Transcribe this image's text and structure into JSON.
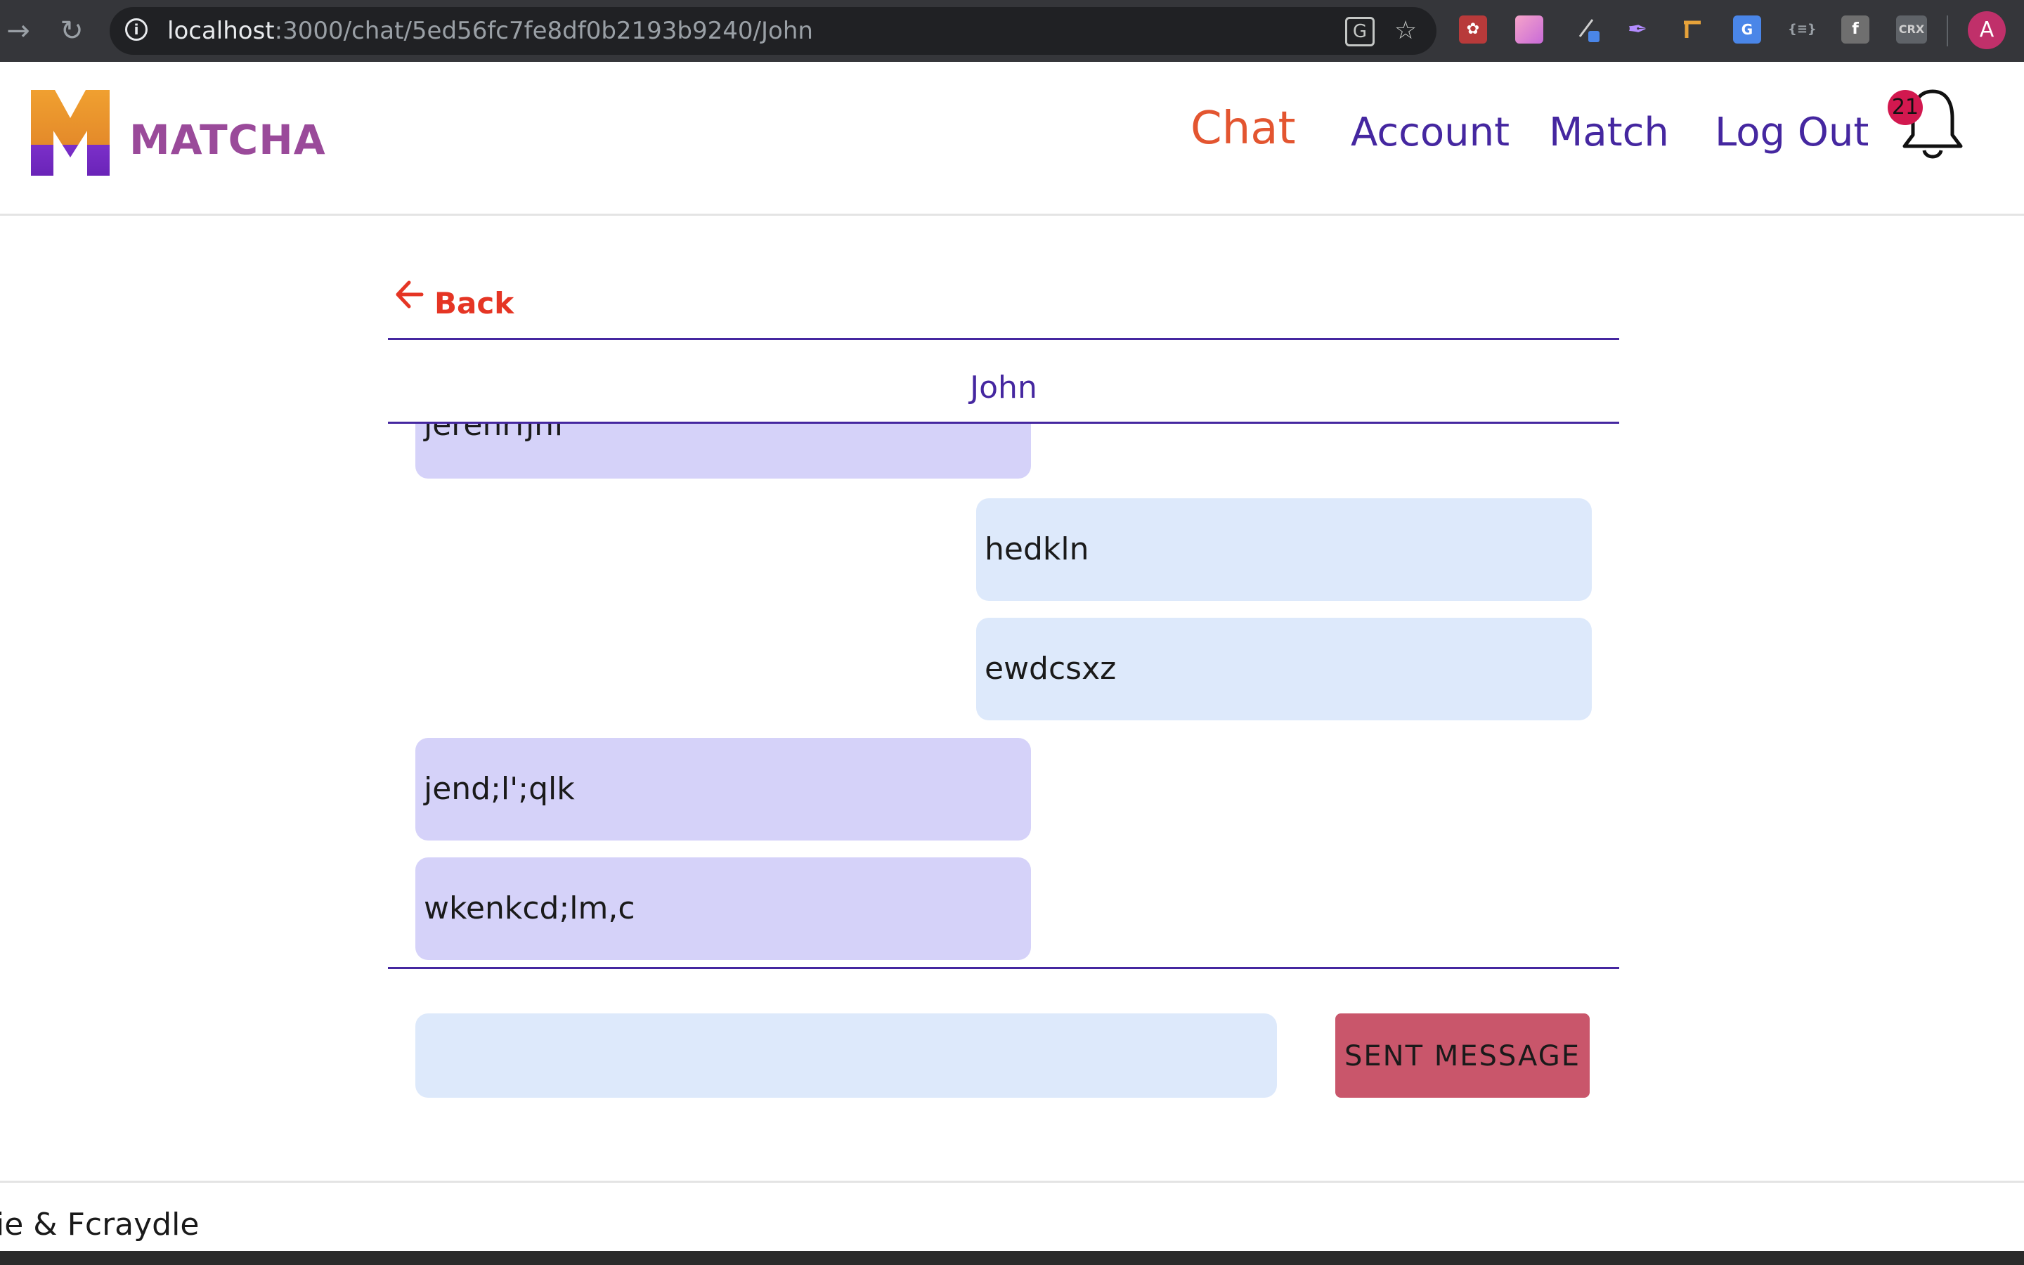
{
  "browser": {
    "url_host": "localhost",
    "url_path": ":3000/chat/5ed56fc7fe8df0b2193b9240/John",
    "profile_initial": "A",
    "extensions": [
      "paw-extension-icon",
      "gradient-extension-icon",
      "picker-extension-icon",
      "feather-extension-icon",
      "ruler-extension-icon",
      "translate-extension-icon",
      "json-extension-icon",
      "f-extension-icon",
      "crx-extension-icon"
    ]
  },
  "header": {
    "logo_text": "MATCHA",
    "nav": {
      "chat": "Chat",
      "account": "Account",
      "match": "Match",
      "logout": "Log Out"
    },
    "notification_count": "21",
    "colors": {
      "active": "#e35530",
      "nav": "#4527a0",
      "badge": "#d2184f"
    }
  },
  "chat": {
    "back_label": "Back",
    "partner_name": "John",
    "messages": [
      {
        "text": "jerenrfjnf",
        "side": "received"
      },
      {
        "text": "hedkln",
        "side": "sent"
      },
      {
        "text": "ewdcsxz",
        "side": "sent"
      },
      {
        "text": "jend;l';qlk",
        "side": "received"
      },
      {
        "text": "wkenkcd;lm,c",
        "side": "received"
      }
    ],
    "input_value": "",
    "send_label": "SENT MESSAGE",
    "colors": {
      "received": "#d5d2f9",
      "sent": "#dde9fb",
      "send_button": "#c9566b",
      "back": "#e53524"
    }
  },
  "footer": {
    "text": "ie & Fcraydle"
  }
}
